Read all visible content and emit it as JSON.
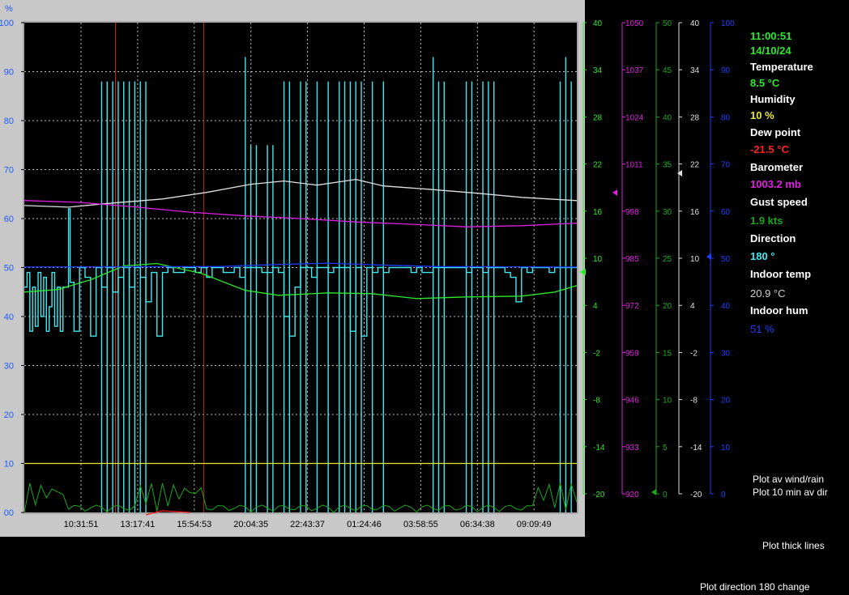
{
  "chart_data": {
    "type": "line",
    "left_axis": {
      "unit": "%",
      "ticks": [
        0,
        10,
        20,
        30,
        40,
        50,
        60,
        70,
        80,
        90,
        100
      ],
      "range": [
        0,
        100
      ],
      "color": "#1f5cff"
    },
    "x_tick_labels": [
      "10:31:51",
      "13:17:41",
      "15:54:53",
      "20:04:35",
      "22:43:37",
      "01:24:46",
      "03:58:55",
      "06:34:38",
      "09:09:49"
    ],
    "right_axes": [
      {
        "name": "temperature",
        "color": "#2ee82e",
        "range": [
          -20,
          40
        ],
        "ticks": [
          40,
          34,
          28,
          22,
          16,
          10,
          4,
          -2,
          -8,
          -14,
          -20
        ]
      },
      {
        "name": "barometer",
        "color": "#e020e0",
        "range": [
          920,
          1050
        ],
        "ticks": [
          1050,
          1037,
          1024,
          1011,
          998,
          985,
          972,
          959,
          946,
          933,
          920
        ]
      },
      {
        "name": "wind",
        "color": "#1aa81a",
        "range": [
          0,
          50
        ],
        "ticks": [
          50,
          45,
          40,
          35,
          30,
          25,
          20,
          15,
          10,
          5,
          0
        ]
      },
      {
        "name": "indoor-temp",
        "color": "#e0e0e0",
        "range": [
          -20,
          40
        ],
        "ticks": [
          40,
          34,
          28,
          22,
          16,
          10,
          4,
          -2,
          -8,
          -14,
          -20
        ]
      },
      {
        "name": "humidity-scale",
        "color": "#1f3cff",
        "range": [
          0,
          100
        ],
        "ticks": [
          100,
          90,
          80,
          70,
          60,
          50,
          40,
          30,
          20,
          10,
          0
        ]
      }
    ],
    "series": [
      {
        "key": "indoor_temp",
        "color": "#e0e0e0",
        "axis": "indoor-temp",
        "points": [
          [
            0,
            17.6
          ],
          [
            0.08,
            17.4
          ],
          [
            0.16,
            17.9
          ],
          [
            0.25,
            18.4
          ],
          [
            0.33,
            19.2
          ],
          [
            0.41,
            20.2
          ],
          [
            0.47,
            20.6
          ],
          [
            0.53,
            20.1
          ],
          [
            0.6,
            20.8
          ],
          [
            0.65,
            20.0
          ],
          [
            0.73,
            19.6
          ],
          [
            0.82,
            19.1
          ],
          [
            0.9,
            18.6
          ],
          [
            1,
            18.2
          ]
        ]
      },
      {
        "key": "barometer",
        "color": "#e020e0",
        "axis": "barometer",
        "points": [
          [
            0,
            1002.8
          ],
          [
            0.1,
            1002.3
          ],
          [
            0.2,
            1001.1
          ],
          [
            0.3,
            999.7
          ],
          [
            0.4,
            998.7
          ],
          [
            0.5,
            998.0
          ],
          [
            0.6,
            997.1
          ],
          [
            0.7,
            996.5
          ],
          [
            0.8,
            995.8
          ],
          [
            0.9,
            996.1
          ],
          [
            1,
            996.8
          ]
        ]
      },
      {
        "key": "temperature",
        "color": "#2ee82e",
        "axis": "temperature",
        "points": [
          [
            0,
            7.0
          ],
          [
            0.06,
            7.3
          ],
          [
            0.12,
            8.5
          ],
          [
            0.18,
            10.2
          ],
          [
            0.24,
            10.5
          ],
          [
            0.32,
            9.3
          ],
          [
            0.4,
            7.2
          ],
          [
            0.46,
            6.6
          ],
          [
            0.55,
            6.9
          ],
          [
            0.63,
            6.8
          ],
          [
            0.71,
            6.2
          ],
          [
            0.8,
            6.4
          ],
          [
            0.9,
            6.5
          ],
          [
            0.96,
            7.0
          ],
          [
            1,
            7.8
          ]
        ]
      },
      {
        "key": "humidity",
        "color": "#1f3cff",
        "axis": "humidity-scale",
        "points": [
          [
            0,
            50.1
          ],
          [
            0.35,
            50.2
          ],
          [
            0.45,
            50.6
          ],
          [
            0.55,
            50.9
          ],
          [
            0.65,
            50.5
          ],
          [
            0.75,
            50.2
          ],
          [
            1,
            50.1
          ]
        ]
      },
      {
        "key": "dew_point",
        "color": "#ff2020",
        "axis": "temperature",
        "points": [
          [
            0.22,
            -20.3
          ],
          [
            0.25,
            -19.8
          ],
          [
            0.3,
            -20.0
          ]
        ]
      },
      {
        "key": "direction_ref",
        "color": "#e8e830",
        "axis": "left",
        "points": [
          [
            0,
            10
          ],
          [
            1,
            10
          ]
        ]
      }
    ],
    "direction_segments": [
      [
        0,
        46
      ],
      [
        0.5,
        49
      ],
      [
        1,
        37
      ],
      [
        1.5,
        46
      ],
      [
        2,
        38
      ],
      [
        2.5,
        49
      ],
      [
        3,
        40
      ],
      [
        3.5,
        48
      ],
      [
        4,
        37
      ],
      [
        4.5,
        42
      ],
      [
        5,
        49
      ],
      [
        5.5,
        38
      ],
      [
        6,
        46
      ],
      [
        6.5,
        37
      ],
      [
        7,
        46
      ],
      [
        8,
        62
      ],
      [
        8.3,
        47
      ],
      [
        9,
        37
      ],
      [
        10,
        50
      ],
      [
        11,
        48
      ],
      [
        12,
        36
      ],
      [
        13,
        50
      ],
      [
        14,
        46
      ],
      [
        15,
        50
      ],
      [
        16,
        45
      ],
      [
        17,
        48
      ],
      [
        18,
        50
      ],
      [
        19,
        46
      ],
      [
        20,
        50
      ],
      [
        21,
        48
      ],
      [
        22,
        43
      ],
      [
        23,
        49
      ],
      [
        24,
        36
      ],
      [
        25,
        49
      ],
      [
        26,
        50
      ],
      [
        27,
        49
      ],
      [
        28,
        49
      ],
      [
        29,
        50
      ],
      [
        30,
        50
      ],
      [
        31,
        49
      ],
      [
        32,
        50
      ],
      [
        33,
        48
      ],
      [
        34,
        50
      ],
      [
        35,
        50
      ],
      [
        36,
        49
      ],
      [
        37,
        49
      ],
      [
        38,
        50
      ],
      [
        39,
        48
      ],
      [
        40,
        50
      ],
      [
        41,
        50
      ],
      [
        42,
        50
      ],
      [
        43,
        49
      ],
      [
        44,
        49
      ],
      [
        45,
        50
      ],
      [
        46,
        49
      ],
      [
        47,
        40
      ],
      [
        48,
        36
      ],
      [
        49,
        46
      ],
      [
        50,
        50
      ],
      [
        51,
        50
      ],
      [
        52,
        48
      ],
      [
        53,
        50
      ],
      [
        54,
        50
      ],
      [
        55,
        49
      ],
      [
        56,
        50
      ],
      [
        57,
        50
      ],
      [
        58,
        50
      ],
      [
        59,
        37
      ],
      [
        60,
        50
      ],
      [
        61,
        36
      ],
      [
        62,
        50
      ],
      [
        63,
        49
      ],
      [
        64,
        50
      ],
      [
        65,
        49
      ],
      [
        66,
        50
      ],
      [
        67,
        50
      ],
      [
        68,
        50
      ],
      [
        69,
        50
      ],
      [
        70,
        49
      ],
      [
        71,
        50
      ],
      [
        72,
        49
      ],
      [
        73,
        49
      ],
      [
        74,
        50
      ],
      [
        75,
        50
      ],
      [
        76,
        50
      ],
      [
        77,
        50
      ],
      [
        78,
        50
      ],
      [
        79,
        50
      ],
      [
        80,
        49
      ],
      [
        81,
        50
      ],
      [
        82,
        50
      ],
      [
        83,
        49
      ],
      [
        84,
        50
      ],
      [
        85,
        50
      ],
      [
        86,
        50
      ],
      [
        87,
        49
      ],
      [
        88,
        48
      ],
      [
        89,
        43
      ],
      [
        90,
        50
      ],
      [
        91,
        49
      ],
      [
        92,
        50
      ],
      [
        93,
        50
      ],
      [
        94,
        50
      ],
      [
        95,
        49
      ],
      [
        96,
        50
      ],
      [
        97,
        50
      ],
      [
        98,
        50
      ],
      [
        99,
        50
      ],
      [
        100,
        50
      ]
    ],
    "markers": [
      {
        "x_fraction_time": 0.165
      },
      {
        "x_fraction_time": 0.325
      }
    ]
  },
  "readouts": {
    "time": "11:00:51",
    "date": "14/10/24",
    "temperature_label": "Temperature",
    "temperature_value": "8.5 °C",
    "humidity_label": "Humidity",
    "humidity_value": "10 %",
    "dewpoint_label": "Dew point",
    "dewpoint_value": "-21.5 °C",
    "barometer_label": "Barometer",
    "barometer_value": "1003.2 mb",
    "gust_label": "Gust speed",
    "gust_value": "1.9 kts",
    "direction_label": "Direction",
    "direction_value": "180 °",
    "indoor_temp_label": "Indoor temp",
    "indoor_temp_value": "20.9 °C",
    "indoor_hum_label": "Indoor hum",
    "indoor_hum_value": "51 %"
  },
  "options": {
    "plot_av_wind": "Plot av wind/rain",
    "plot_10min": "Plot 10 min av dir",
    "plot_thick": "Plot thick lines",
    "plot_direction": "Plot direction 180 change"
  },
  "colors": {
    "time": "#2ee82e",
    "date": "#2ee82e",
    "temperature": "#2ee82e",
    "humidity": "#e8e830",
    "dewpoint": "#ff2020",
    "barometer": "#e020e0",
    "gust": "#1aa81a",
    "direction": "#40e8f0",
    "indoor_temp": "#d0d0d0",
    "indoor_hum": "#1f3cff"
  }
}
